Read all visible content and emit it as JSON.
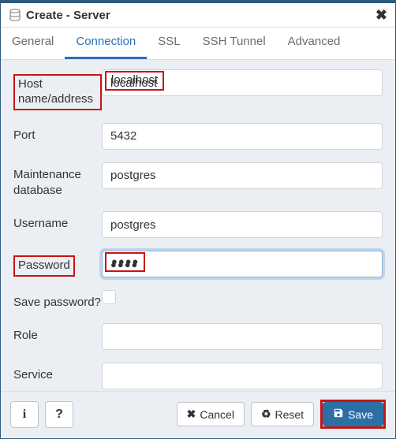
{
  "window": {
    "title": "Create - Server"
  },
  "tabs": [
    "General",
    "Connection",
    "SSL",
    "SSH Tunnel",
    "Advanced"
  ],
  "active_tab": "Connection",
  "form": {
    "host": {
      "label": "Host name/address",
      "value": "localhost"
    },
    "port": {
      "label": "Port",
      "value": "5432"
    },
    "maint_db": {
      "label": "Maintenance database",
      "value": "postgres"
    },
    "username": {
      "label": "Username",
      "value": "postgres"
    },
    "password": {
      "label": "Password",
      "value": "●●●●"
    },
    "save_password": {
      "label": "Save password?",
      "checked": false
    },
    "role": {
      "label": "Role",
      "value": ""
    },
    "service": {
      "label": "Service",
      "value": ""
    }
  },
  "footer": {
    "cancel": "Cancel",
    "reset": "Reset",
    "save": "Save"
  }
}
